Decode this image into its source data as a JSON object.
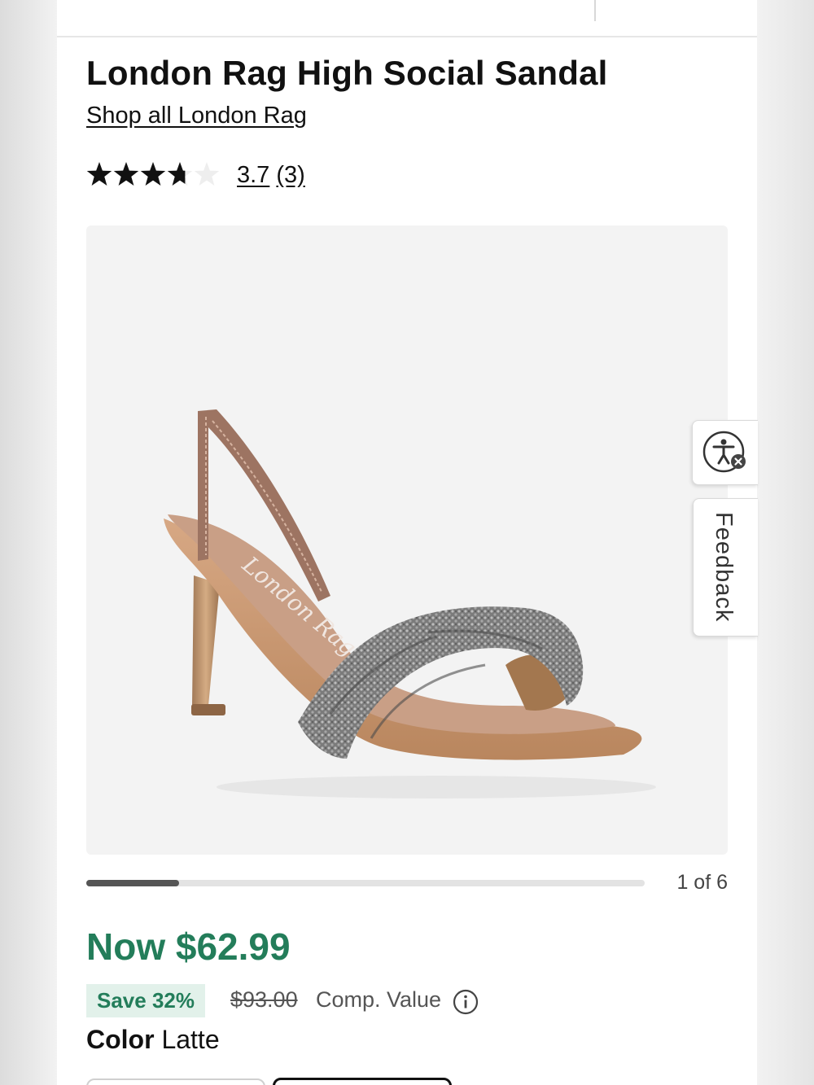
{
  "product": {
    "title": "London Rag High Social Sandal",
    "brand_link": "Shop all London Rag"
  },
  "rating": {
    "score": 3.7,
    "score_label": "3.7",
    "count_label": "(3)",
    "max_stars": 5
  },
  "gallery": {
    "image_alt": "Braided rhinestone slingback heel sandal",
    "counter": "1 of 6",
    "current_index": 1,
    "total": 6,
    "progress_fraction": 0.1667
  },
  "pricing": {
    "now_price": "Now $62.99",
    "save_badge": "Save 32%",
    "was_price": "$93.00",
    "comp_label": "Comp. Value"
  },
  "color": {
    "label": "Color",
    "value": "Latte"
  },
  "side_tabs": {
    "accessibility_icon": "accessibility-icon",
    "feedback_label": "Feedback"
  },
  "colors": {
    "price_green": "#237d5a",
    "save_bg": "#e2f1ea",
    "star_fill": "#111111",
    "star_empty": "#eeeeee"
  }
}
